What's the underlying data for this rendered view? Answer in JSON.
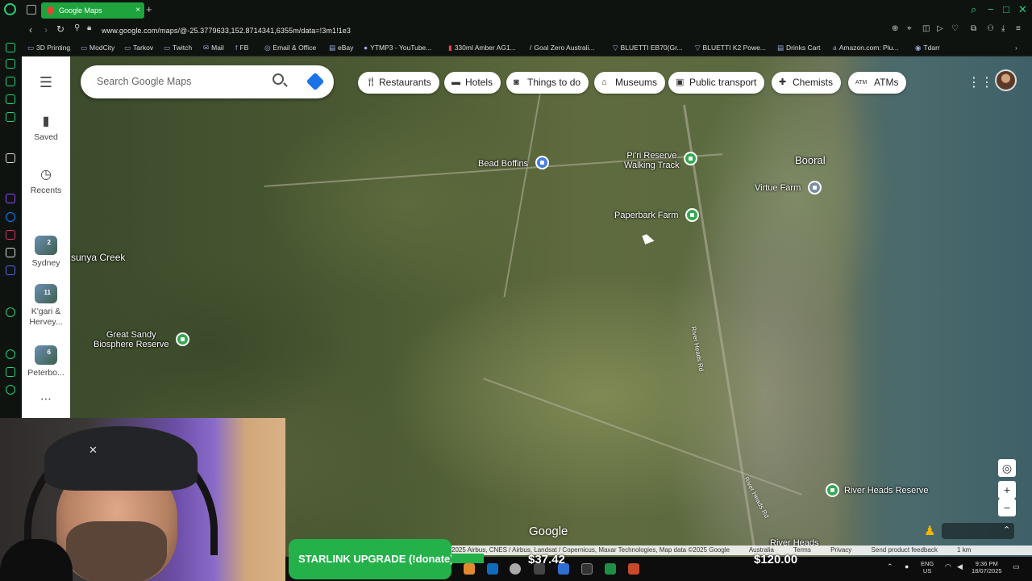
{
  "browser": {
    "tab_title": "Google Maps",
    "tab_close": "×",
    "new_tab": "+",
    "url": "www.google.com/maps/@-25.3779633,152.8714341,6355m/data=!3m1!1e3",
    "bookmarks": [
      "3D Printing",
      "ModCity",
      "Tarkov",
      "Twitch",
      "Mail",
      "FB",
      "Email & Office",
      "eBay",
      "YTMP3 - YouTube...",
      "330ml Amber AG1...",
      "Goal Zero Australi...",
      "BLUETTI EB70(Gr...",
      "BLUETTI K2 Powe...",
      "Drinks Cart",
      "Amazon.com: Plu...",
      "Tdarr"
    ],
    "accent_color": "#24d37a"
  },
  "maps_sidebar": {
    "menu_icon": "☰",
    "saved_label": "Saved",
    "recents_label": "Recents",
    "lists": [
      {
        "badge": "2",
        "label": "Sydney"
      },
      {
        "badge": "11",
        "label": "K'gari & Hervey..."
      },
      {
        "badge": "6",
        "label": "Peterbo..."
      }
    ],
    "more": "⋯"
  },
  "search": {
    "placeholder": "Search Google Maps"
  },
  "chips": [
    "Restaurants",
    "Hotels",
    "Things to do",
    "Museums",
    "Public transport",
    "Chemists",
    "ATMs"
  ],
  "map": {
    "places": {
      "bead_boffins": "Bead Boffins",
      "piri_reserve": "Pi'ri Reserve\nWalking Track",
      "booral": "Booral",
      "virtue_farm": "Virtue Farm",
      "paperbark_farm": "Paperbark Farm",
      "sunya_creek": "sunya Creek",
      "great_sandy": "Great Sandy\nBiosphere Reserve",
      "river_heads_reserve": "River Heads Reserve",
      "river_heads": "River Heads"
    },
    "roads": {
      "river_heads_rd_1": "River Heads Rd",
      "river_heads_rd_2": "River Heads Rd"
    },
    "google_logo": "Google",
    "attribution": "2025 Airbus, CNES / Airbus, Landsat / Copernicus, Maxar Technologies, Map data ©2025 Google",
    "attribution_links": [
      "Australia",
      "Terms",
      "Privacy",
      "Send product feedback"
    ],
    "scale": "1 km",
    "zoom_in": "+",
    "zoom_out": "−"
  },
  "overlay": {
    "starlink": "STARLINK UPGRADE (!donate)",
    "raised": "$37.42",
    "goal": "$120.00",
    "progress_fraction": 0.31
  },
  "taskbar": {
    "lang": "ENG\nUS",
    "time": "9:36 PM",
    "date": "18/07/2025"
  }
}
